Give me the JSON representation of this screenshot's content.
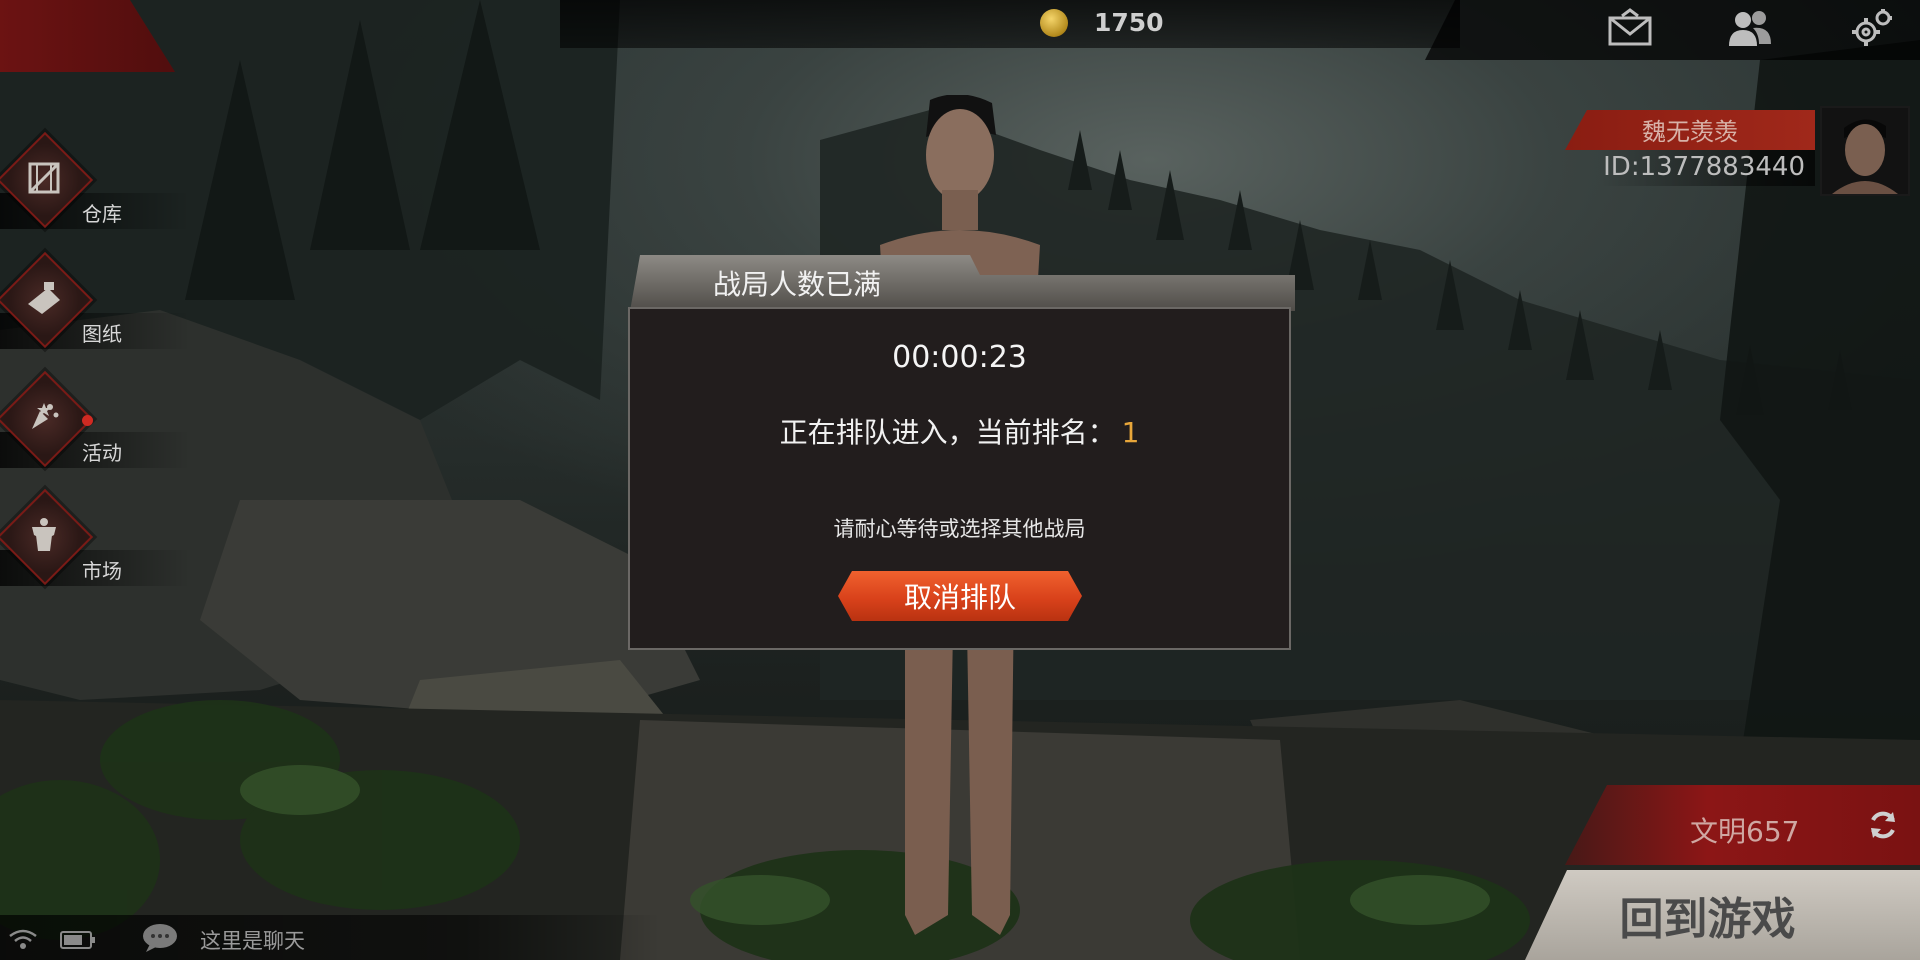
{
  "top_bar": {
    "coins": "1750",
    "icons": [
      "mail-icon",
      "friends-icon",
      "settings-icon"
    ]
  },
  "side_menu": {
    "items": [
      {
        "label": "仓库",
        "icon": "crate-icon",
        "has_badge": false
      },
      {
        "label": "图纸",
        "icon": "blueprint-icon",
        "has_badge": false
      },
      {
        "label": "活动",
        "icon": "event-icon",
        "has_badge": true
      },
      {
        "label": "市场",
        "icon": "market-icon",
        "has_badge": false
      }
    ]
  },
  "player": {
    "name": "魏无羡羡",
    "id": "ID:1377883440"
  },
  "dialog": {
    "title": "战局人数已满",
    "timer": "00:00:23",
    "queue_text": "正在排队进入，当前排名：",
    "queue_rank": "1",
    "hint": "请耐心等待或选择其他战局",
    "cancel_label": "取消排队"
  },
  "bottom_right": {
    "civilization": "文明657",
    "return_label": "回到游戏"
  },
  "chat": {
    "placeholder": "这里是聊天"
  },
  "colors": {
    "accent_red": "#8c1616",
    "button_orange": "#d9421b",
    "rank_gold": "#e8a63a",
    "dialog_bg": "#221d1d"
  }
}
